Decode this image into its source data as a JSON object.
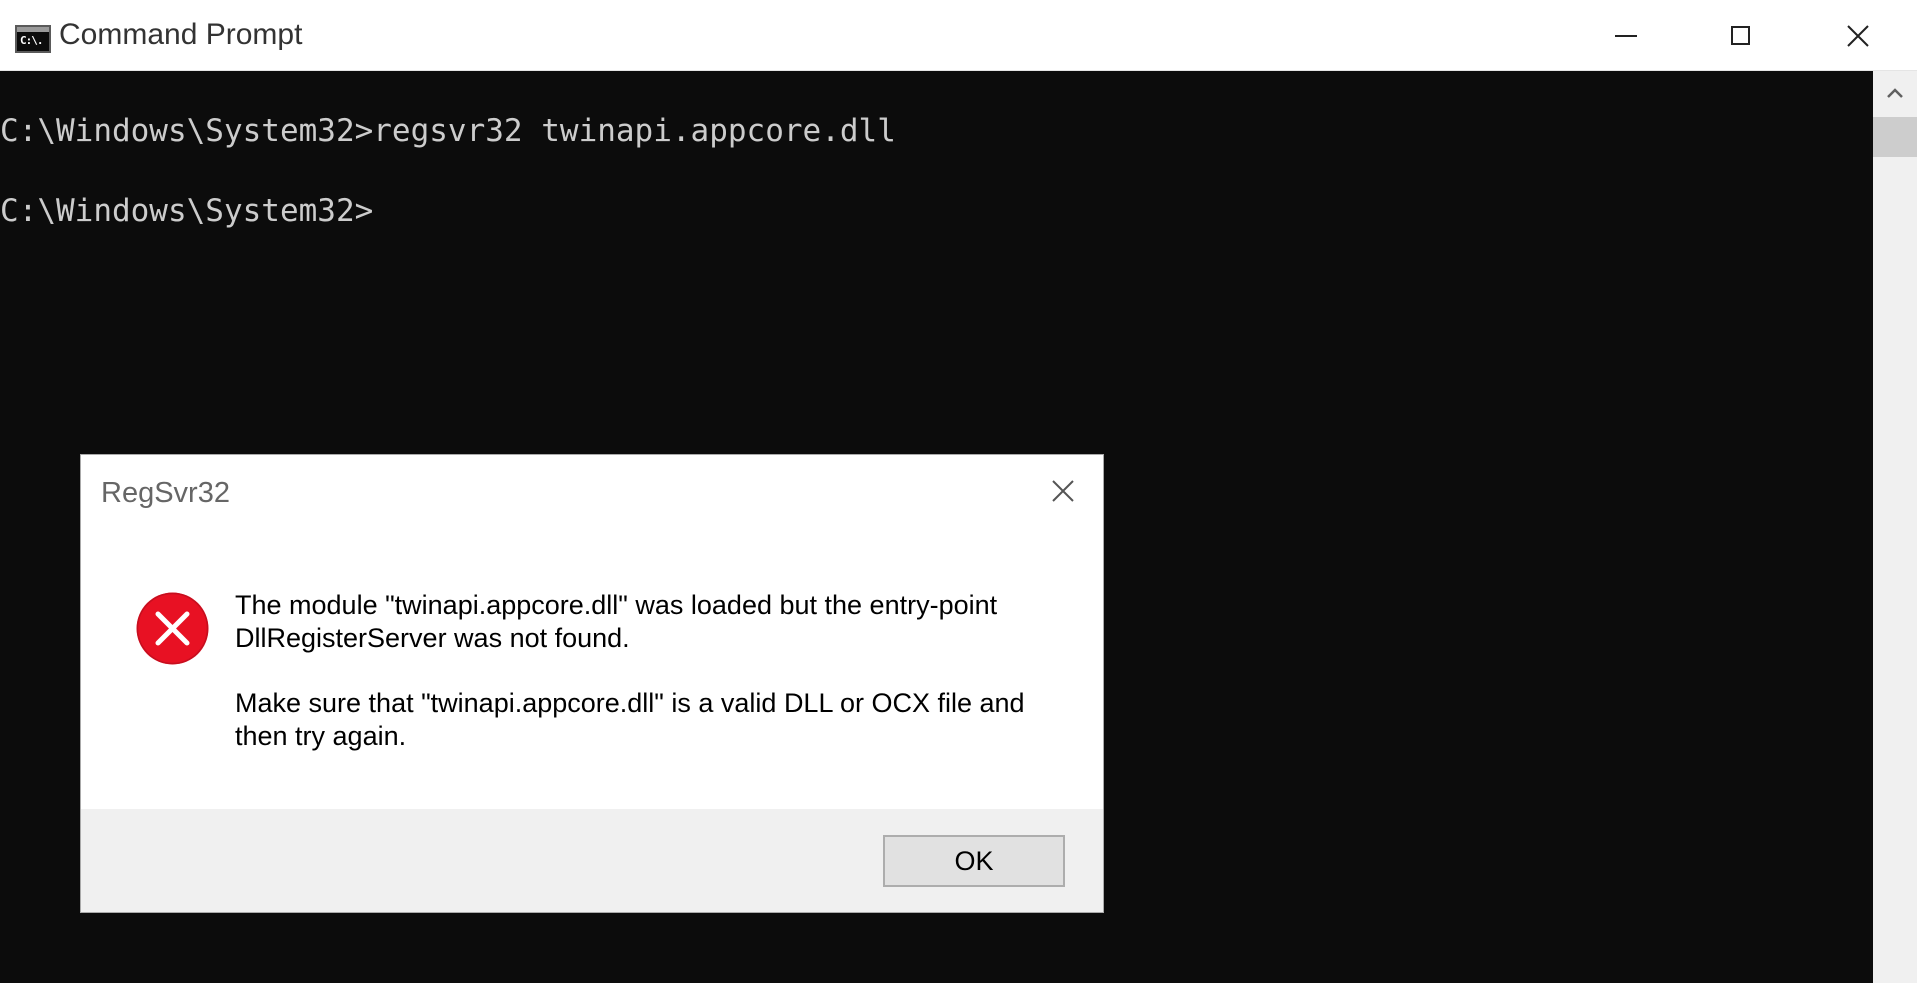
{
  "window": {
    "title": "Command Prompt",
    "icon": "cmd-icon",
    "icon_text": "C:\\."
  },
  "console": {
    "lines": [
      "C:\\Windows\\System32>regsvr32 twinapi.appcore.dll",
      "C:\\Windows\\System32>"
    ]
  },
  "dialog": {
    "title": "RegSvr32",
    "icon": "error-icon",
    "message_1": "The module \"twinapi.appcore.dll\" was loaded but the entry-point DllRegisterServer was not found.",
    "message_2": "Make sure that \"twinapi.appcore.dll\" is a valid DLL or OCX file and then try again.",
    "ok_label": "OK"
  },
  "colors": {
    "console_bg": "#0c0c0c",
    "console_text": "#cccccc",
    "error_red": "#e81123"
  }
}
